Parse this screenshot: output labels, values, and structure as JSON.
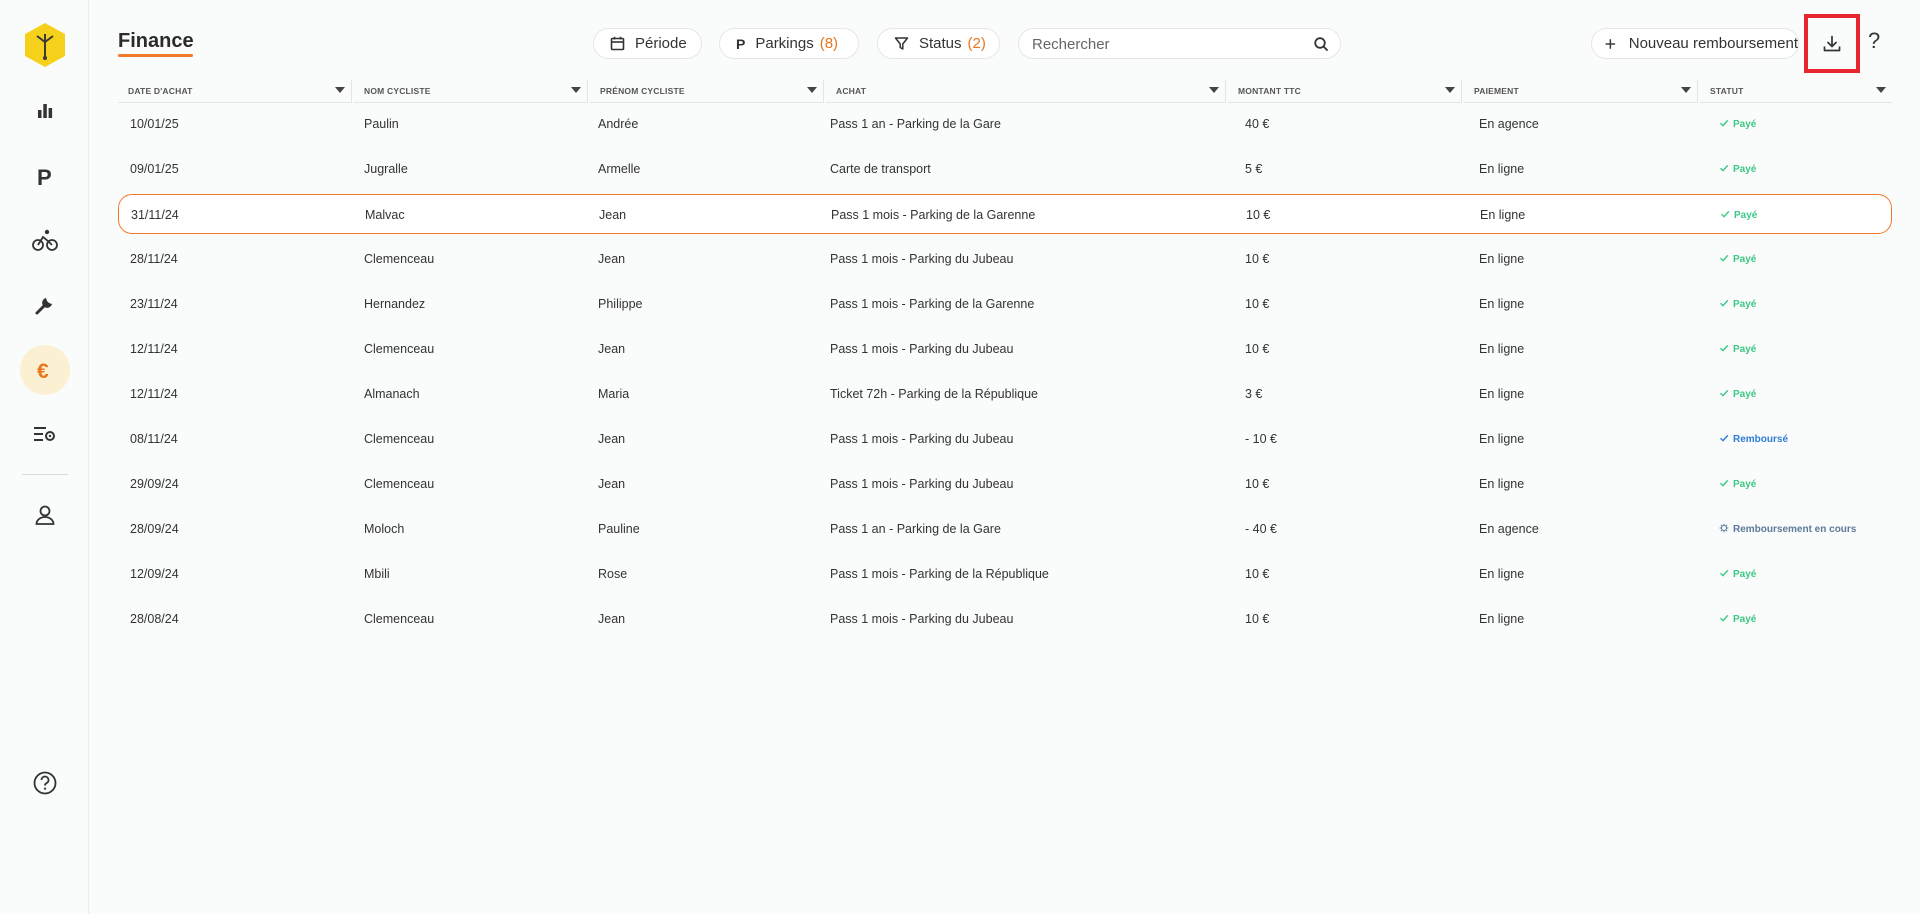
{
  "page": {
    "title": "Finance"
  },
  "filters": {
    "periode": {
      "label": "Période"
    },
    "parkings": {
      "label": "Parkings",
      "count": "(8)"
    },
    "status": {
      "label": "Status",
      "count": "(2)"
    }
  },
  "search": {
    "placeholder": "Rechercher",
    "value": ""
  },
  "actions": {
    "new_label": "Nouveau remboursement",
    "help": "?"
  },
  "table": {
    "columns": [
      "DATE D'ACHAT",
      "NOM CYCLISTE",
      "PRÉNOM CYCLISTE",
      "ACHAT",
      "MONTANT TTC",
      "PAIEMENT",
      "STATUT"
    ],
    "rows": [
      [
        "10/01/25",
        "Paulin",
        "Andrée",
        "Pass 1 an - Parking de la Gare",
        "40 €",
        "En agence",
        "Payé"
      ],
      [
        "09/01/25",
        "Jugralle",
        "Armelle",
        "Carte de transport",
        "5 €",
        "En ligne",
        "Payé"
      ],
      [
        "31/11/24",
        "Malvac",
        "Jean",
        "Pass 1 mois - Parking de la Garenne",
        "10 €",
        "En ligne",
        "Payé"
      ],
      [
        "28/11/24",
        "Clemenceau",
        "Jean",
        "Pass 1 mois - Parking du Jubeau",
        "10 €",
        "En ligne",
        "Payé"
      ],
      [
        "23/11/24",
        "Hernandez",
        "Philippe",
        "Pass 1 mois - Parking de la Garenne",
        "10 €",
        "En ligne",
        "Payé"
      ],
      [
        "12/11/24",
        "Clemenceau",
        "Jean",
        "Pass 1 mois - Parking du Jubeau",
        "10 €",
        "En ligne",
        "Payé"
      ],
      [
        "12/11/24",
        "Almanach",
        "Maria",
        "Ticket 72h - Parking de la République",
        "3 €",
        "En ligne",
        "Payé"
      ],
      [
        "08/11/24",
        "Clemenceau",
        "Jean",
        "Pass 1 mois - Parking du Jubeau",
        "- 10 €",
        "En ligne",
        "Remboursé"
      ],
      [
        "29/09/24",
        "Clemenceau",
        "Jean",
        "Pass 1 mois - Parking du Jubeau",
        "10 €",
        "En ligne",
        "Payé"
      ],
      [
        "28/09/24",
        "Moloch",
        "Pauline",
        "Pass 1 an - Parking de la Gare",
        "- 40 €",
        "En agence",
        "Remboursement en cours"
      ],
      [
        "12/09/24",
        "Mbili",
        "Rose",
        "Pass 1 mois - Parking de la République",
        "10 €",
        "En ligne",
        "Payé"
      ],
      [
        "28/08/24",
        "Clemenceau",
        "Jean",
        "Pass 1 mois - Parking du Jubeau",
        "10 €",
        "En ligne",
        "Payé"
      ]
    ],
    "highlighted_row": 2
  },
  "colors": {
    "accent": "#f07a2c",
    "paid": "#3dc786",
    "refunded": "#2f7bd9",
    "refund_pending": "#5c7a99",
    "logo": "#f5d11c",
    "download_highlight": "#e8262b"
  }
}
